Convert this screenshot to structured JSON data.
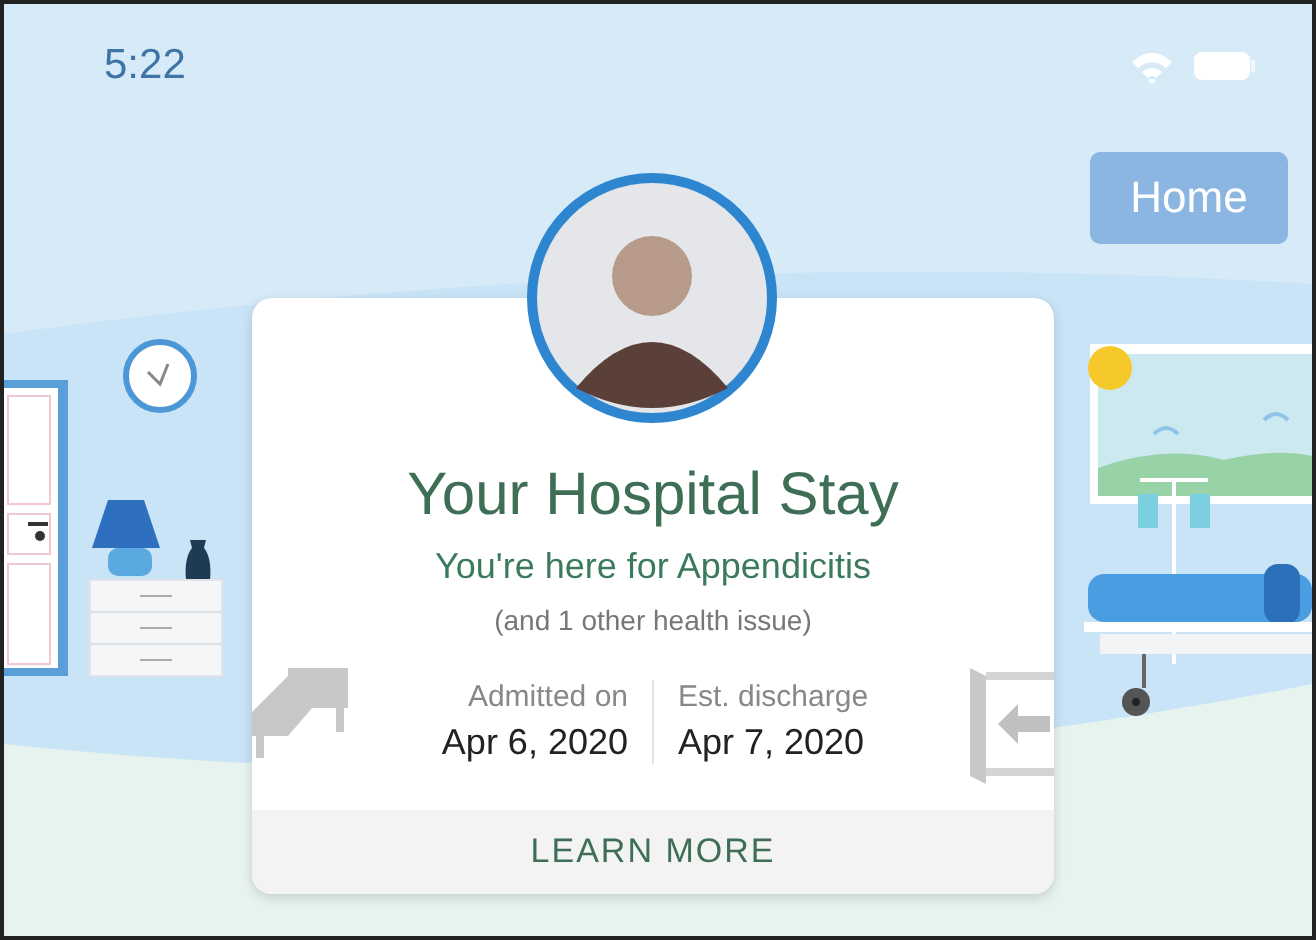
{
  "status_bar": {
    "time": "5:22"
  },
  "home_button": {
    "label": "Home"
  },
  "stay_card": {
    "title": "Your Hospital Stay",
    "reason": "You're here for Appendicitis",
    "note": "(and 1 other health issue)",
    "dates": [
      {
        "kind": "admitted",
        "label": "Admitted on",
        "value": "Apr 6, 2020"
      },
      {
        "kind": "discharge",
        "label": "Est. discharge",
        "value": "Apr 7, 2020"
      }
    ],
    "action": "LEARN MORE"
  }
}
